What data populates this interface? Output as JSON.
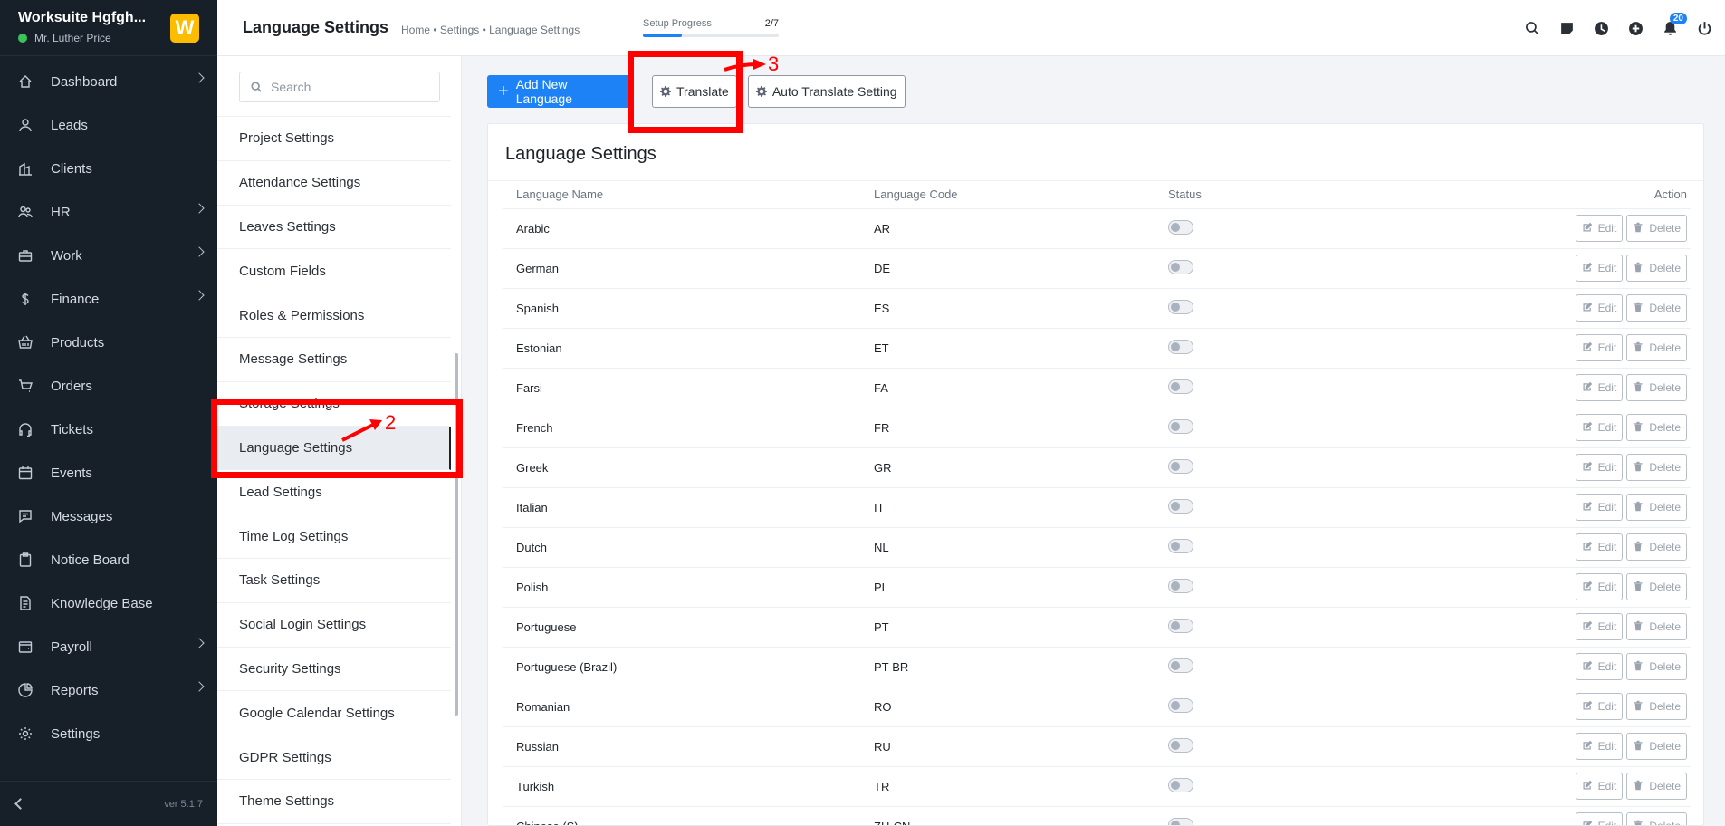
{
  "brand": {
    "title": "Worksuite Hgfgh...",
    "user": "Mr. Luther Price",
    "logo_letter": "W"
  },
  "nav": [
    {
      "label": "Dashboard",
      "icon": "home-icon",
      "has_children": true
    },
    {
      "label": "Leads",
      "icon": "user-icon",
      "has_children": false
    },
    {
      "label": "Clients",
      "icon": "building-icon",
      "has_children": false
    },
    {
      "label": "HR",
      "icon": "users-icon",
      "has_children": true
    },
    {
      "label": "Work",
      "icon": "briefcase-icon",
      "has_children": true
    },
    {
      "label": "Finance",
      "icon": "dollar-icon",
      "has_children": true
    },
    {
      "label": "Products",
      "icon": "basket-icon",
      "has_children": false
    },
    {
      "label": "Orders",
      "icon": "cart-icon",
      "has_children": false
    },
    {
      "label": "Tickets",
      "icon": "headset-icon",
      "has_children": false
    },
    {
      "label": "Events",
      "icon": "calendar-icon",
      "has_children": false
    },
    {
      "label": "Messages",
      "icon": "chat-icon",
      "has_children": false
    },
    {
      "label": "Notice Board",
      "icon": "clipboard-icon",
      "has_children": false
    },
    {
      "label": "Knowledge Base",
      "icon": "document-icon",
      "has_children": false
    },
    {
      "label": "Payroll",
      "icon": "wallet-icon",
      "has_children": true
    },
    {
      "label": "Reports",
      "icon": "pie-chart-icon",
      "has_children": true
    },
    {
      "label": "Settings",
      "icon": "gear-icon",
      "has_children": false
    }
  ],
  "version": "ver 5.1.7",
  "header": {
    "title": "Language Settings",
    "breadcrumb": "Home • Settings • Language Settings",
    "progress_label": "Setup Progress",
    "progress_value": "2/7",
    "progress_fraction": 0.2857,
    "notification_count": "20"
  },
  "submenu": {
    "search_placeholder": "Search",
    "items": [
      "Project Settings",
      "Attendance Settings",
      "Leaves Settings",
      "Custom Fields",
      "Roles & Permissions",
      "Message Settings",
      "Storage Settings",
      "Language Settings",
      "Lead Settings",
      "Time Log Settings",
      "Task Settings",
      "Social Login Settings",
      "Security Settings",
      "Google Calendar Settings",
      "GDPR Settings",
      "Theme Settings"
    ],
    "active_index": 7
  },
  "actions": {
    "add_label": "Add New Language",
    "translate_label": "Translate",
    "auto_translate_label": "Auto Translate Setting"
  },
  "card": {
    "title": "Language Settings",
    "columns": [
      "Language Name",
      "Language Code",
      "Status",
      "Action"
    ],
    "edit_label": "Edit",
    "delete_label": "Delete",
    "rows": [
      {
        "name": "Arabic",
        "code": "AR"
      },
      {
        "name": "German",
        "code": "DE"
      },
      {
        "name": "Spanish",
        "code": "ES"
      },
      {
        "name": "Estonian",
        "code": "ET"
      },
      {
        "name": "Farsi",
        "code": "FA"
      },
      {
        "name": "French",
        "code": "FR"
      },
      {
        "name": "Greek",
        "code": "GR"
      },
      {
        "name": "Italian",
        "code": "IT"
      },
      {
        "name": "Dutch",
        "code": "NL"
      },
      {
        "name": "Polish",
        "code": "PL"
      },
      {
        "name": "Portuguese",
        "code": "PT"
      },
      {
        "name": "Portuguese (Brazil)",
        "code": "PT-BR"
      },
      {
        "name": "Romanian",
        "code": "RO"
      },
      {
        "name": "Russian",
        "code": "RU"
      },
      {
        "name": "Turkish",
        "code": "TR"
      },
      {
        "name": "Chinese (S)",
        "code": "ZH-CN"
      }
    ]
  },
  "annotations": {
    "step_2": "2",
    "step_3": "3",
    "color": "#ff0000"
  },
  "colors": {
    "accent": "#1d82f5",
    "sidebar": "#171f29",
    "brand_logo": "#fcbd01"
  }
}
